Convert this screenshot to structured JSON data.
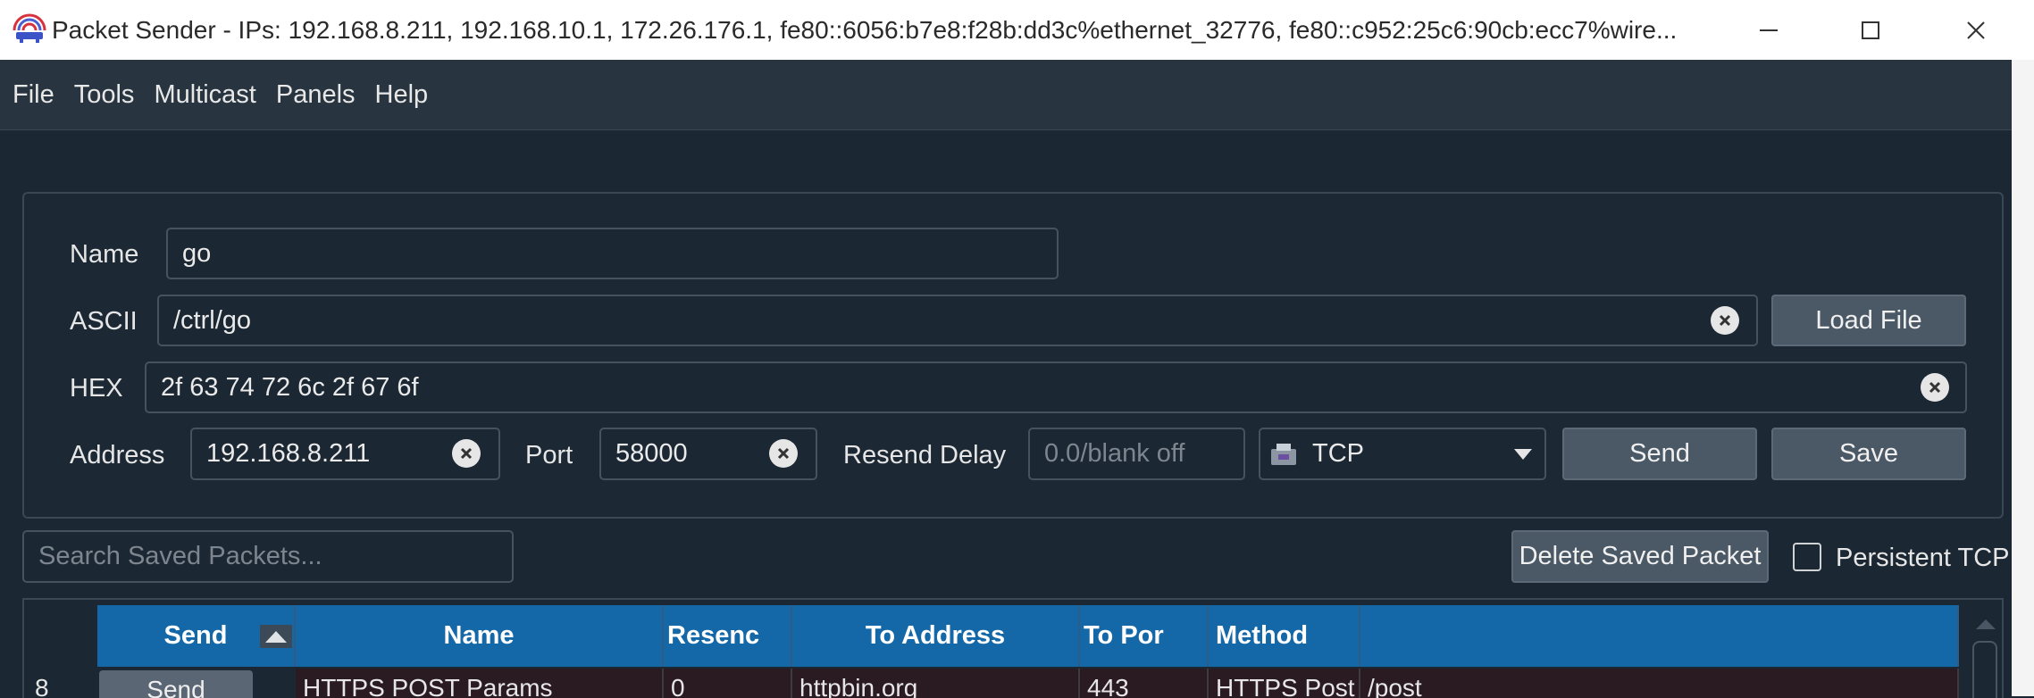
{
  "window": {
    "title": "Packet Sender - IPs: 192.168.8.211, 192.168.10.1, 172.26.176.1, fe80::6056:b7e8:f28b:dd3c%ethernet_32776, fe80::c952:25c6:90cb:ecc7%wire..."
  },
  "menu": [
    "File",
    "Tools",
    "Multicast",
    "Panels",
    "Help"
  ],
  "form": {
    "name_label": "Name",
    "name_value": "go",
    "ascii_label": "ASCII",
    "ascii_value": "/ctrl/go",
    "load_file_label": "Load File",
    "hex_label": "HEX",
    "hex_value": "2f 63 74 72 6c 2f 67 6f",
    "address_label": "Address",
    "address_value": "192.168.8.211",
    "port_label": "Port",
    "port_value": "58000",
    "resend_label": "Resend Delay",
    "resend_placeholder": "0.0/blank off",
    "protocol_value": "TCP",
    "send_label": "Send",
    "save_label": "Save"
  },
  "toolbar": {
    "search_placeholder": "Search Saved Packets...",
    "delete_label": "Delete Saved Packet",
    "persistent_label": "Persistent TCP",
    "persistent_checked": false
  },
  "table": {
    "columns": [
      "Send",
      "Name",
      "Resenc",
      "To Address",
      "To Por",
      "Method",
      ""
    ],
    "rows": [
      {
        "row_num": "8",
        "send": "Send",
        "name": "HTTPS POST Params",
        "resend": "0",
        "to_address": "httpbin.org",
        "to_port": "443",
        "method": "HTTPS Post",
        "extra": "/post"
      }
    ]
  },
  "colors": {
    "header_blue": "#1468a8",
    "background": "#1b2733"
  }
}
